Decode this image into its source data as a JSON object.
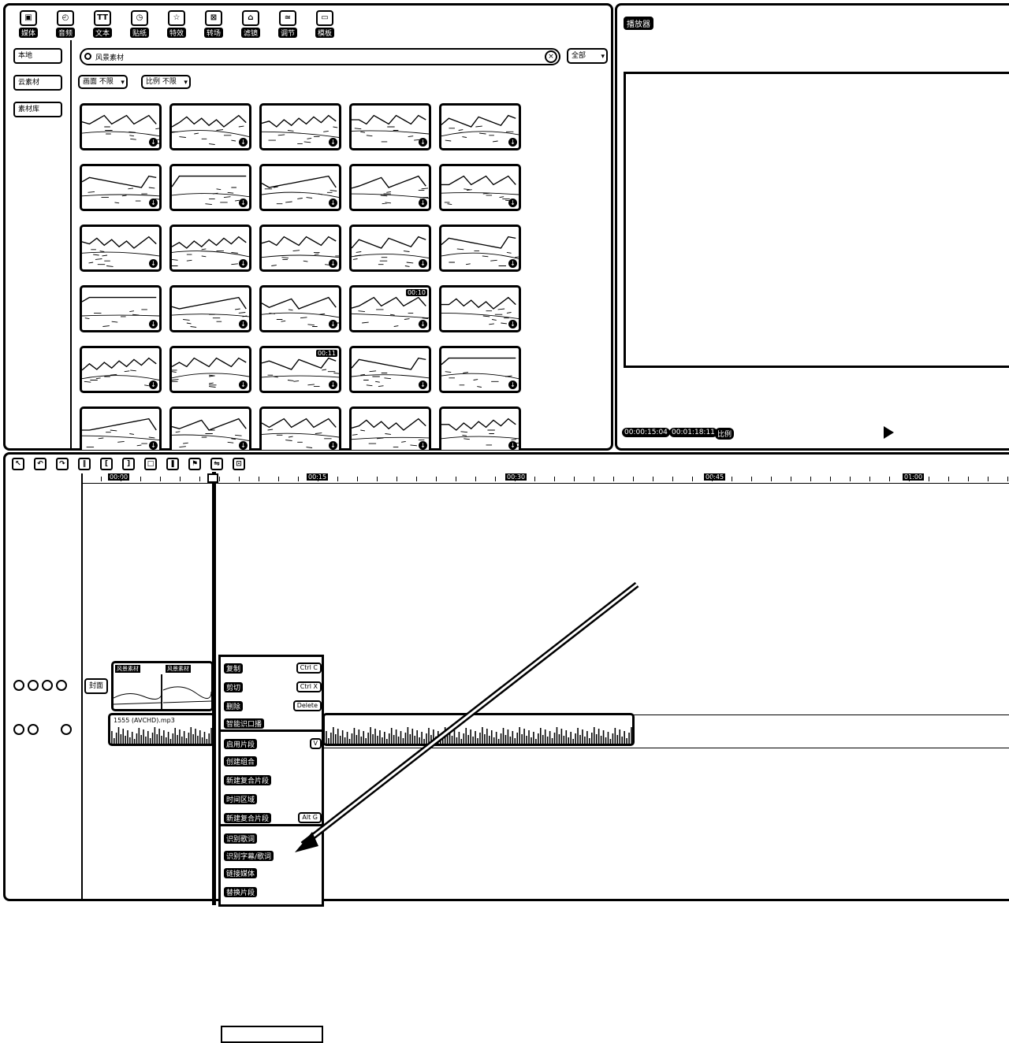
{
  "toolbar": {
    "items": [
      {
        "label": "媒体",
        "icon": "media-icon"
      },
      {
        "label": "音频",
        "icon": "audio-icon"
      },
      {
        "label": "文本",
        "icon": "text-icon"
      },
      {
        "label": "贴纸",
        "icon": "sticker-icon"
      },
      {
        "label": "特效",
        "icon": "effects-icon"
      },
      {
        "label": "转场",
        "icon": "transition-icon"
      },
      {
        "label": "滤镜",
        "icon": "filter-icon"
      },
      {
        "label": "调节",
        "icon": "adjust-icon"
      },
      {
        "label": "模板",
        "icon": "template-icon"
      }
    ]
  },
  "sidebar": {
    "items": [
      {
        "label": "本地"
      },
      {
        "label": "云素材"
      },
      {
        "label": "素材库"
      }
    ]
  },
  "search": {
    "value": "风景素材",
    "filter_all": "全部"
  },
  "filters": [
    {
      "label": "画面 不限"
    },
    {
      "label": "比例 不限"
    }
  ],
  "thumbnails": [
    {
      "duration": ""
    },
    {
      "duration": ""
    },
    {
      "duration": ""
    },
    {
      "duration": ""
    },
    {
      "duration": ""
    },
    {
      "duration": ""
    },
    {
      "duration": ""
    },
    {
      "duration": ""
    },
    {
      "duration": ""
    },
    {
      "duration": ""
    },
    {
      "duration": ""
    },
    {
      "duration": ""
    },
    {
      "duration": ""
    },
    {
      "duration": ""
    },
    {
      "duration": ""
    },
    {
      "duration": ""
    },
    {
      "duration": ""
    },
    {
      "duration": ""
    },
    {
      "duration": "00:10"
    },
    {
      "duration": ""
    },
    {
      "duration": ""
    },
    {
      "duration": ""
    },
    {
      "duration": "00:11"
    },
    {
      "duration": ""
    },
    {
      "duration": ""
    },
    {
      "duration": ""
    },
    {
      "duration": ""
    },
    {
      "duration": ""
    },
    {
      "duration": ""
    },
    {
      "duration": ""
    }
  ],
  "player": {
    "title": "播放器",
    "current_time": "00:00:15:04",
    "total_time": "00:01:18:11",
    "ratio": "比例"
  },
  "timeline": {
    "tools": [
      "select-icon",
      "undo-icon",
      "redo-icon",
      "split-icon",
      "split-left-icon",
      "split-right-icon",
      "delete-icon",
      "freeze-icon",
      "mark-icon",
      "mirror-icon",
      "crop-icon"
    ],
    "ruler_labels": [
      "00:00",
      "00:15",
      "00:30",
      "00:45",
      "01:00"
    ],
    "cover_label": "封面",
    "video_clips": [
      {
        "name": "风景素材"
      },
      {
        "name": "风景素材"
      }
    ],
    "audio_clip": {
      "name": "1555 (AVCHD).mp3"
    }
  },
  "context_menu": {
    "items": [
      {
        "label": "复制",
        "key": "Ctrl C"
      },
      {
        "label": "剪切",
        "key": "Ctrl X"
      },
      {
        "label": "删除",
        "key": "Delete"
      },
      {
        "label": "智能识口播",
        "key": ""
      },
      {
        "label": "启用片段",
        "key": "V"
      },
      {
        "label": "创建组合",
        "key": ""
      },
      {
        "label": "新建复合片段",
        "key": ""
      },
      {
        "label": "时间区域",
        "key": ""
      },
      {
        "label": "新建复合片段",
        "key": "Alt G"
      },
      {
        "label": "识别歌词",
        "key": ""
      },
      {
        "label": "识别字幕/歌词",
        "key": ""
      },
      {
        "label": "链接媒体",
        "key": ""
      },
      {
        "label": "替换片段",
        "key": ""
      }
    ]
  }
}
